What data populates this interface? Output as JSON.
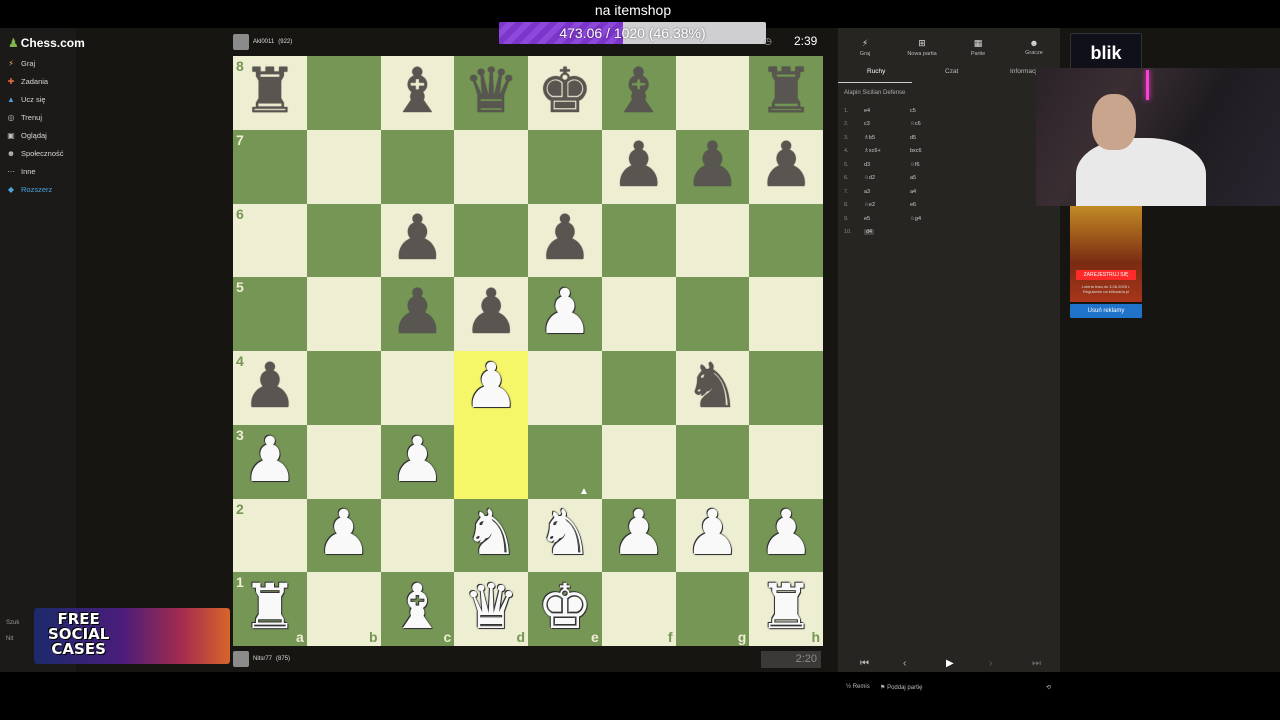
{
  "overlay": {
    "title": "na itemshop",
    "goal_text": "473.06 / 1020 (46.38%)",
    "goal_fraction": 0.4638
  },
  "site": {
    "logo": "Chess.com"
  },
  "sidebar": {
    "items": [
      {
        "label": "Graj",
        "icon": "bolt-icon",
        "color": "#e7b94a"
      },
      {
        "label": "Zadania",
        "icon": "puzzle-icon",
        "color": "#e5683d"
      },
      {
        "label": "Ucz się",
        "icon": "cap-icon",
        "color": "#4a9de0"
      },
      {
        "label": "Trenuj",
        "icon": "target-icon",
        "color": "#bbbbbb"
      },
      {
        "label": "Oglądaj",
        "icon": "tv-icon",
        "color": "#bbbbbb"
      },
      {
        "label": "Społeczność",
        "icon": "people-icon",
        "color": "#bbbbbb"
      },
      {
        "label": "Inne",
        "icon": "more-icon",
        "color": "#bbbbbb"
      },
      {
        "label": "Rozszerz",
        "icon": "gem-icon",
        "color": "#4aa3df"
      }
    ],
    "ad_text": [
      "FREE",
      "SOCIAL",
      "CASES"
    ],
    "bottom": [
      "Szuk",
      "Nit"
    ]
  },
  "players": {
    "top": {
      "name": "Akl0011",
      "rating": "(922)",
      "clock": "2:39"
    },
    "bottom": {
      "name": "Nitsr77",
      "rating": "(875)",
      "clock": "2:20"
    }
  },
  "board": {
    "rank_labels": [
      "8",
      "7",
      "6",
      "5",
      "4",
      "3",
      "2",
      "1"
    ],
    "file_labels": [
      "a",
      "b",
      "c",
      "d",
      "e",
      "f",
      "g",
      "h"
    ],
    "ranks": [
      [
        "br",
        "",
        "bb",
        "bq",
        "bk",
        "bb",
        "",
        "br"
      ],
      [
        "",
        "",
        "",
        "",
        "",
        "bp",
        "bp",
        "bp"
      ],
      [
        "",
        "",
        "bp",
        "",
        "bp",
        "",
        "",
        ""
      ],
      [
        "",
        "",
        "bp",
        "bp",
        "wp",
        "",
        "",
        ""
      ],
      [
        "bp",
        "",
        "",
        "wp",
        "",
        "",
        "bn",
        ""
      ],
      [
        "wp",
        "",
        "wp",
        "",
        "",
        "",
        "",
        ""
      ],
      [
        "",
        "wp",
        "",
        "wn",
        "wn",
        "wp",
        "wp",
        "wp"
      ],
      [
        "wr",
        "",
        "wb",
        "wq",
        "wk",
        "",
        "",
        "wr"
      ]
    ],
    "highlight": [
      "d4",
      "d3"
    ],
    "light_color": "#eeeed2",
    "dark_color": "#769656",
    "highlight_color": "#f6f669"
  },
  "panel": {
    "top_buttons": [
      {
        "label": "Graj",
        "icon": "bolt-icon"
      },
      {
        "label": "Nowa partia",
        "icon": "plus-icon"
      },
      {
        "label": "Partie",
        "icon": "grid-icon"
      },
      {
        "label": "Gracze",
        "icon": "people-icon"
      }
    ],
    "tabs": [
      "Ruchy",
      "Czat",
      "Informacje"
    ],
    "opening": "Alapin Sicilian Defense",
    "moves": [
      {
        "n": "1.",
        "w": "e4",
        "b": "c5"
      },
      {
        "n": "2.",
        "w": "c3",
        "b": "♘c6"
      },
      {
        "n": "3.",
        "w": "♗b5",
        "b": "d5"
      },
      {
        "n": "4.",
        "w": "♗xc6+",
        "b": "bxc6"
      },
      {
        "n": "5.",
        "w": "d3",
        "b": "♘f6"
      },
      {
        "n": "6.",
        "w": "♘d2",
        "b": "a5"
      },
      {
        "n": "7.",
        "w": "a3",
        "b": "a4"
      },
      {
        "n": "8.",
        "w": "♘e2",
        "b": "e6"
      },
      {
        "n": "9.",
        "w": "e5",
        "b": "♘g4"
      },
      {
        "n": "10.",
        "w": "d4",
        "b": ""
      }
    ],
    "footer": {
      "draw": "Remis",
      "resign": "Poddaj partię"
    }
  },
  "ads": {
    "blik": "blik",
    "gold_cta": "ZAREJESTRUJ SIĘ",
    "gold_small": "Loteria trwa do 3.06.2026 r. Regulamin na bilionaria.pl",
    "remove": "Usuń reklamy"
  }
}
